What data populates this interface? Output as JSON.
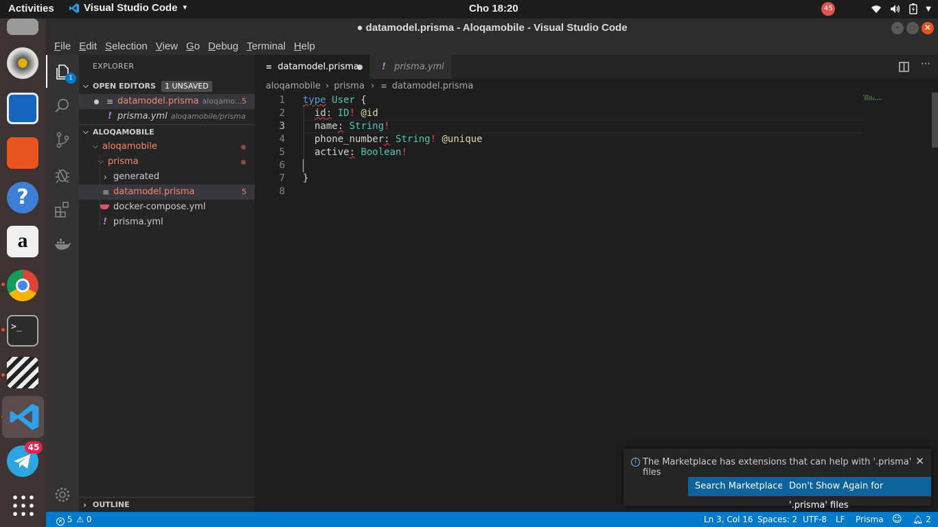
{
  "topbar": {
    "activities": "Activities",
    "app_name": "Visual Studio Code",
    "clock": "Cho 18:20",
    "notif_count": "45"
  },
  "window": {
    "title": "● datamodel.prisma - Aloqamobile - Visual Studio Code"
  },
  "menubar": [
    "File",
    "Edit",
    "Selection",
    "View",
    "Go",
    "Debug",
    "Terminal",
    "Help"
  ],
  "activity_bar": {
    "explorer_badge": "1"
  },
  "dock": {
    "telegram_badge": "45"
  },
  "sidebar": {
    "title": "EXPLORER",
    "open_editors": {
      "header": "OPEN EDITORS",
      "badge": "1 UNSAVED",
      "items": [
        {
          "name": "datamodel.prisma",
          "desc": "aloqamo...",
          "count": "5"
        },
        {
          "name": "prisma.yml",
          "desc": "aloqamobile/prisma"
        }
      ]
    },
    "project": {
      "header": "ALOQAMOBILE",
      "tree": [
        {
          "label": "aloqamobile"
        },
        {
          "label": "prisma"
        },
        {
          "label": "generated"
        },
        {
          "label": "datamodel.prisma",
          "count": "5"
        },
        {
          "label": "docker-compose.yml"
        },
        {
          "label": "prisma.yml"
        }
      ]
    },
    "outline": "OUTLINE"
  },
  "tabs": [
    {
      "label": "datamodel.prisma"
    },
    {
      "label": "prisma.yml"
    }
  ],
  "breadcrumb": [
    "aloqamobile",
    "prisma",
    "datamodel.prisma"
  ],
  "editor": {
    "line_numbers": [
      "1",
      "2",
      "3",
      "4",
      "5",
      "6",
      "7",
      "8"
    ],
    "code": {
      "l1_kw": "type",
      "l1_name": " User",
      "l1_brace": " {",
      "l2_field": "id",
      "l2_type": "ID",
      "l2_attr": "@id",
      "l3_field": "name",
      "l3_type": "String",
      "l4_field": "phone_number",
      "l4_type": "String",
      "l4_attr": "@unique",
      "l5_field": "active",
      "l5_type": "Boolean",
      "l7_brace": "}",
      "colon": ":",
      "bang": "!"
    }
  },
  "notification": {
    "message": "The Marketplace has extensions that can help with '.prisma' files",
    "primary_button": "Search Marketplace",
    "secondary_button": "Don't Show Again for '.prisma' files"
  },
  "statusbar": {
    "errors": "5",
    "warnings": "0",
    "position": "Ln 3, Col 16",
    "spaces": "Spaces: 2",
    "encoding": "UTF-8",
    "eol": "LF",
    "language": "Prisma",
    "bell_count": "2"
  },
  "colors": {
    "accent": "#007acc",
    "error": "#f48771",
    "ubuntu_orange": "#e95420"
  }
}
